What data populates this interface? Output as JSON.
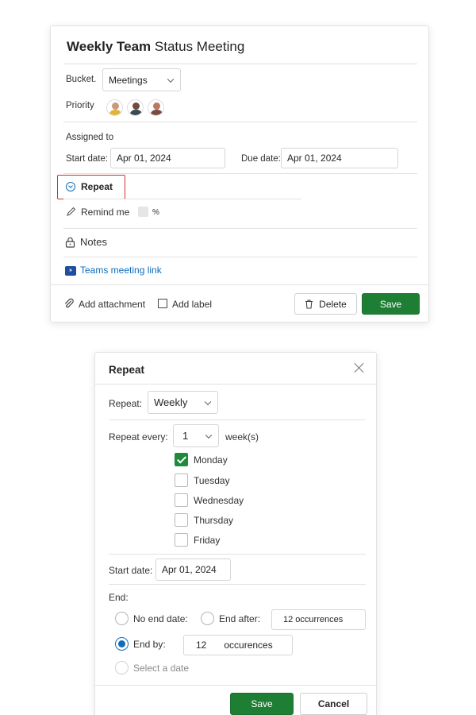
{
  "task": {
    "title_bold": "Weekly Team",
    "title_rest": " Status Meeting",
    "bucket_label": "Bucket.",
    "bucket_value": "Meetings",
    "priority_label": "Priority",
    "assigned_label": "Assigned to",
    "start_label": "Start date:",
    "start_value": "Apr 01, 2024",
    "due_label": "Due date:",
    "due_value": "Apr 01, 2024",
    "repeat_label": "Repeat",
    "remind_label": "Remind me",
    "remind_unit": "%",
    "notes_label": "Notes",
    "teams_link": "Teams meeting link",
    "add_attachment": "Add attachment",
    "add_label": "Add label",
    "delete": "Delete",
    "save": "Save"
  },
  "repeat_dialog": {
    "title": "Repeat",
    "repeat_label": "Repeat:",
    "repeat_value": "Weekly",
    "every_label": "Repeat every:",
    "every_value": "1",
    "every_unit": "week(s)",
    "days": [
      {
        "label": "Monday",
        "checked": true
      },
      {
        "label": "Tuesday",
        "checked": false
      },
      {
        "label": "Wednesday",
        "checked": false
      },
      {
        "label": "Thursday",
        "checked": false
      },
      {
        "label": "Friday",
        "checked": false
      }
    ],
    "start_label": "Start date:",
    "start_value": "Apr 01, 2024",
    "end_label": "End:",
    "no_end": "No end date:",
    "end_after": "End after:",
    "end_after_value": "12 occurrences",
    "end_by": "End by:",
    "end_by_num": "12",
    "end_by_unit": "occurences",
    "select_date": "Select a date",
    "save": "Save",
    "cancel": "Cancel"
  },
  "colors": {
    "accent_green": "#1e7e34",
    "link_blue": "#0f6cbd",
    "highlight_red": "#d32f2f"
  }
}
